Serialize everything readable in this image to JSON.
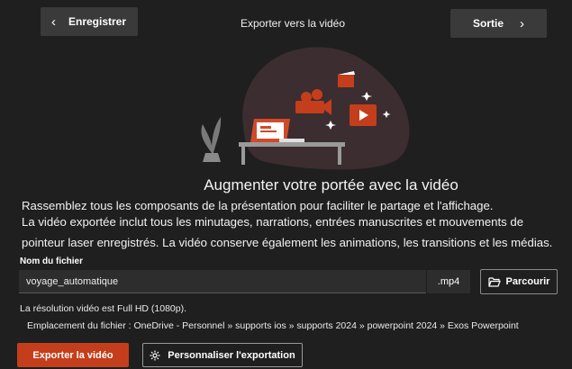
{
  "header": {
    "back_label": "Enregistrer",
    "title": "Exporter vers la vidéo",
    "exit_label": "Sortie"
  },
  "main": {
    "heading": "Augmenter votre portée avec la vidéo",
    "description_lines": [
      "Rassemblez tous les composants de la présentation pour faciliter le partage et l'affichage.",
      "La vidéo exportée inclut tous les minutages, narrations, entrées manuscrites et mouvements de",
      "pointeur laser enregistrés. La vidéo conserve également les animations, les transitions et les médias."
    ],
    "file_name_label": "Nom du fichier",
    "file_name_value": "voyage_automatique",
    "file_extension": ".mp4",
    "browse_label": "Parcourir",
    "resolution_text": "La résolution vidéo est Full HD (1080p).",
    "location_text": "Emplacement du fichier : OneDrive - Personnel » supports ios » supports 2024 » powerpoint 2024 » Exos Powerpoint"
  },
  "actions": {
    "export_label": "Exporter la vidéo",
    "customize_label": "Personnaliser l'exportation"
  },
  "colors": {
    "background": "#1f1f1f",
    "accent": "#c43e1c",
    "illustration_blob": "#3c2d30"
  },
  "icons": {
    "back": "chevron-left-icon",
    "exit": "chevron-right-icon",
    "browse": "folder-open-icon",
    "customize": "gear-icon"
  }
}
